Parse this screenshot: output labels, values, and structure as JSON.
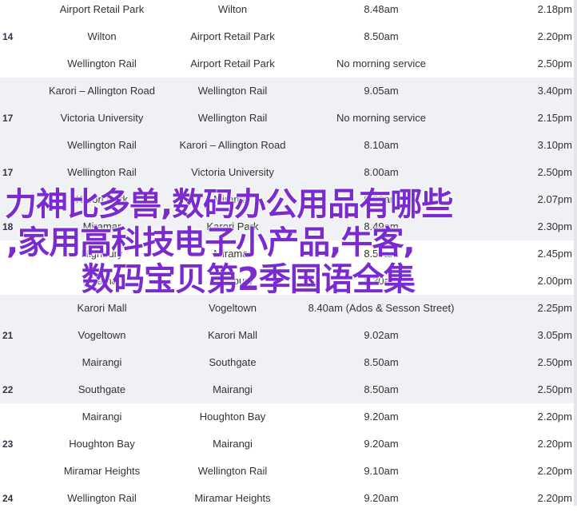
{
  "rows": [
    {
      "route": "",
      "from": "Airport Retail Park",
      "to": "Wilton",
      "time": "8.48am",
      "fare": "2.18pm",
      "shaded": false
    },
    {
      "route": "14",
      "from": "Wilton",
      "to": "Airport Retail Park",
      "time": "8.50am",
      "fare": "2.20pm",
      "shaded": false
    },
    {
      "route": "",
      "from": "Wellington Rail",
      "to": "Airport Retail Park",
      "time": "No morning service",
      "fare": "2.50pm",
      "shaded": false
    },
    {
      "route": "",
      "from": "Karori – Allington Road",
      "to": "Wellington Rail",
      "time": "9.05am",
      "fare": "3.40pm",
      "shaded": true
    },
    {
      "route": "17",
      "from": "Victoria University",
      "to": "Wellington Rail",
      "time": "No morning service",
      "fare": "2.15pm",
      "shaded": true
    },
    {
      "route": "",
      "from": "Wellington Rail",
      "to": "Karori – Allington Road",
      "time": "8.10am",
      "fare": "3.10pm",
      "shaded": true
    },
    {
      "route": "17",
      "from": "Wellington Rail",
      "to": "Victoria University",
      "time": "8.00am",
      "fare": "2.50pm",
      "shaded": true
    },
    {
      "route": "",
      "from": "Karori Park",
      "to": "Miramar",
      "time": "9.09am",
      "fare": "2.07pm",
      "shaded": true
    },
    {
      "route": "18",
      "from": "Miramar",
      "to": "Karori Park",
      "time": "8.49am",
      "fare": "2.30pm",
      "shaded": true
    },
    {
      "route": "",
      "from": "Highbury",
      "to": "Miramar",
      "time": "8.50am",
      "fare": "2.45pm",
      "shaded": false
    },
    {
      "route": "",
      "from": "Miramar",
      "to": "Highbury",
      "time": "8.30am",
      "fare": "2.00pm",
      "shaded": false
    },
    {
      "route": "",
      "from": "Karori Mall",
      "to": "Vogeltown",
      "time": "8.40am (Ados & Sesson Street)",
      "fare": "2.25pm",
      "shaded": true
    },
    {
      "route": "21",
      "from": "Vogeltown",
      "to": "Karori Mall",
      "time": "9.02am",
      "fare": "3.05pm",
      "shaded": true
    },
    {
      "route": "",
      "from": "Mairangi",
      "to": "Southgate",
      "time": "8.50am",
      "fare": "2.50pm",
      "shaded": true
    },
    {
      "route": "22",
      "from": "Southgate",
      "to": "Mairangi",
      "time": "8.50am",
      "fare": "2.50pm",
      "shaded": true
    },
    {
      "route": "",
      "from": "Mairangi",
      "to": "Houghton Bay",
      "time": "9.20am",
      "fare": "2.20pm",
      "shaded": false
    },
    {
      "route": "23",
      "from": "Houghton Bay",
      "to": "Mairangi",
      "time": "9.20am",
      "fare": "2.20pm",
      "shaded": false
    },
    {
      "route": "",
      "from": "Miramar Heights",
      "to": "Wellington Rail",
      "time": "9.10am",
      "fare": "2.20pm",
      "shaded": false
    },
    {
      "route": "24",
      "from": "Wellington Rail",
      "to": "Miramar Heights",
      "time": "9.20am",
      "fare": "2.20pm",
      "shaded": false
    }
  ],
  "overlay": {
    "line1": "力神比多兽,数码办公用品有哪些",
    "line2": ",家用高科技电子小产品,牛客,",
    "line3": "数码宝贝第2季国语全集"
  }
}
